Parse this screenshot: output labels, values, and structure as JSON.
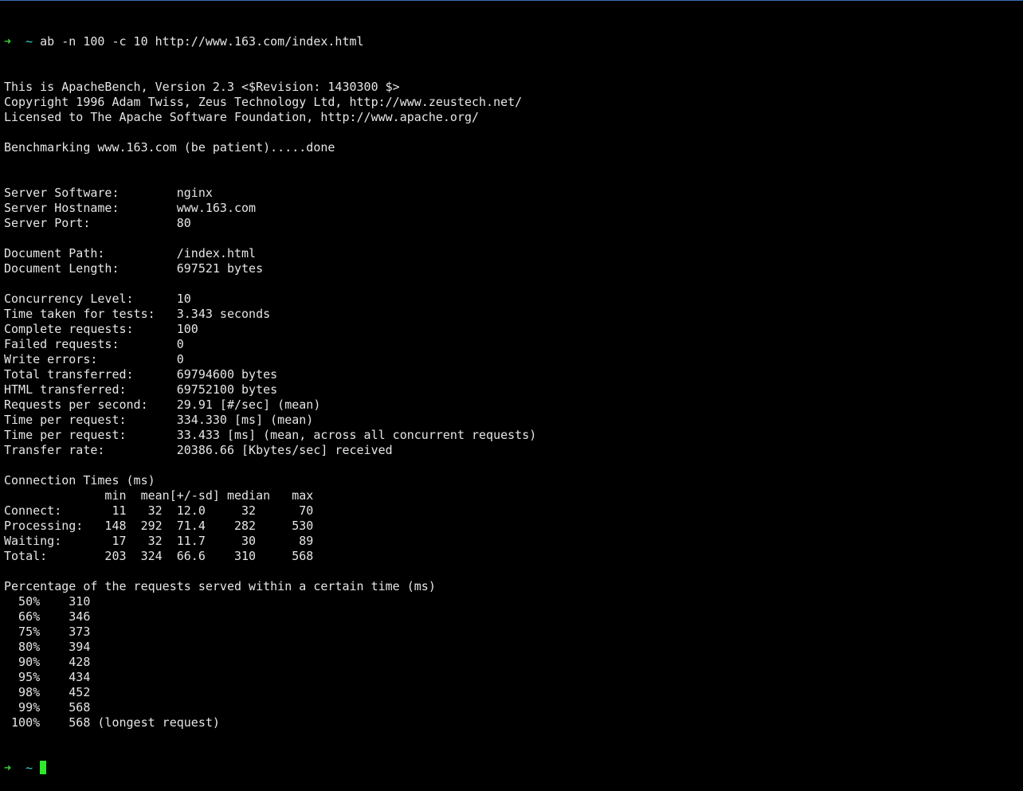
{
  "colors": {
    "background": "#000000",
    "text": "#e6e6e6",
    "prompt_arrow": "#38d338",
    "prompt_tilde": "#38d0d0",
    "cursor": "#2ee82e",
    "window_border": "#3b6fb6"
  },
  "prompt": {
    "arrow": "➜",
    "cwd": "~",
    "command": "ab -n 100 -c 10 http://www.163.com/index.html"
  },
  "output_lines": [
    "This is ApacheBench, Version 2.3 <$Revision: 1430300 $>",
    "Copyright 1996 Adam Twiss, Zeus Technology Ltd, http://www.zeustech.net/",
    "Licensed to The Apache Software Foundation, http://www.apache.org/",
    "",
    "Benchmarking www.163.com (be patient).....done",
    "",
    "",
    "Server Software:        nginx",
    "Server Hostname:        www.163.com",
    "Server Port:            80",
    "",
    "Document Path:          /index.html",
    "Document Length:        697521 bytes",
    "",
    "Concurrency Level:      10",
    "Time taken for tests:   3.343 seconds",
    "Complete requests:      100",
    "Failed requests:        0",
    "Write errors:           0",
    "Total transferred:      69794600 bytes",
    "HTML transferred:       69752100 bytes",
    "Requests per second:    29.91 [#/sec] (mean)",
    "Time per request:       334.330 [ms] (mean)",
    "Time per request:       33.433 [ms] (mean, across all concurrent requests)",
    "Transfer rate:          20386.66 [Kbytes/sec] received",
    "",
    "Connection Times (ms)",
    "              min  mean[+/-sd] median   max",
    "Connect:       11   32  12.0     32      70",
    "Processing:   148  292  71.4    282     530",
    "Waiting:       17   32  11.7     30      89",
    "Total:        203  324  66.6    310     568",
    "",
    "Percentage of the requests served within a certain time (ms)",
    "  50%    310",
    "  66%    346",
    "  75%    373",
    "  80%    394",
    "  90%    428",
    "  95%    434",
    "  98%    452",
    "  99%    568",
    " 100%    568 (longest request)"
  ],
  "final_prompt": {
    "arrow": "➜",
    "cwd": "~"
  }
}
